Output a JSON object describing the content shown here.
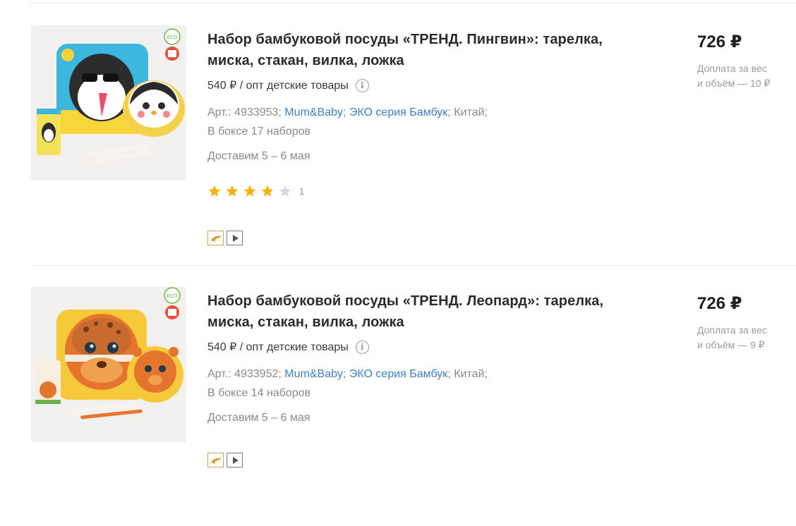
{
  "products": [
    {
      "title": "Набор бамбуковой посуды «ТРЕНД. Пингвин»: тарелка, миска, стакан, вилка, ложка",
      "wholesale_text": "540 ₽ / опт детские товары",
      "article_prefix": "Арт.: 4933953; ",
      "brand": "Mum&Baby",
      "sep1": "; ",
      "series": "ЭКО серия Бамбук",
      "country": "; Китай;",
      "box": "В боксе 17 наборов",
      "delivery": "Доставим 5 – 6 мая",
      "rating": 4,
      "rating_count": "1",
      "price": "726 ₽",
      "surcharge_line1": "Доплата за вес",
      "surcharge_line2": "и объём — 10 ₽",
      "image_theme": "penguin"
    },
    {
      "title": "Набор бамбуковой посуды «ТРЕНД. Леопард»: тарелка, миска, стакан, вилка, ложка",
      "wholesale_text": "540 ₽ / опт детские товары",
      "article_prefix": "Арт.: 4933952; ",
      "brand": "Mum&Baby",
      "sep1": "; ",
      "series": "ЭКО серия Бамбук",
      "country": "; Китай;",
      "box": "В боксе 14 наборов",
      "delivery": "Доставим 5 – 6 мая",
      "price": "726 ₽",
      "surcharge_line1": "Доплата за вес",
      "surcharge_line2": "и объём — 9 ₽",
      "image_theme": "leopard"
    }
  ],
  "icons": {
    "info": "i",
    "star_filled_color": "#f5b301",
    "star_empty_color": "#d9d9d9",
    "badge_dolphin": "dolphin-icon",
    "badge_video": "play-icon"
  }
}
